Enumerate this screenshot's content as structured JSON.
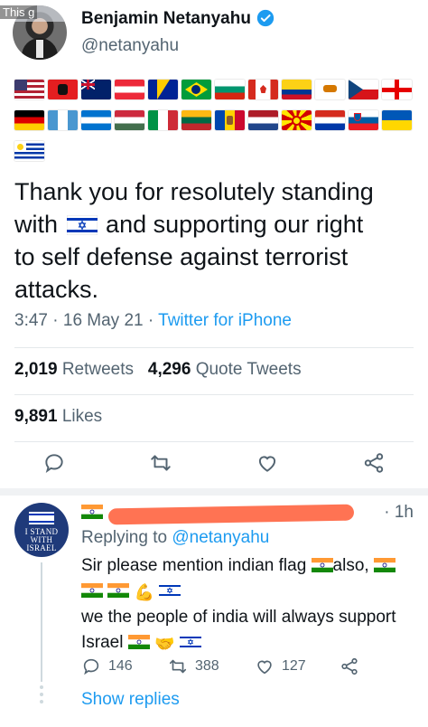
{
  "overlay": {
    "text": "This g"
  },
  "tweet": {
    "author_name": "Benjamin Netanyahu",
    "author_handle": "@netanyahu",
    "text_line1": "Thank you for resolutely standing",
    "text_line2a": "with",
    "text_line2b": "and supporting our right",
    "text_line3": "to self defense against terrorist",
    "text_line4": "attacks.",
    "time": "3:47",
    "date": "16 May 21",
    "source": "Twitter for iPhone",
    "retweets_count": "2,019",
    "retweets_label": "Retweets",
    "quotes_count": "4,296",
    "quotes_label": "Quote Tweets",
    "likes_count": "9,891",
    "likes_label": "Likes"
  },
  "flags_row1": [
    "United States",
    "Albania",
    "Australia",
    "Austria",
    "Bosnia and Herzegovina",
    "Brazil",
    "Bulgaria",
    "Canada",
    "Colombia",
    "Cyprus",
    "Czech Republic",
    "Georgia"
  ],
  "flags_row2": [
    "Germany",
    "Guatemala",
    "Honduras",
    "Hungary",
    "Italy",
    "Lithuania",
    "Moldova",
    "Netherlands",
    "North Macedonia",
    "Paraguay",
    "Slovenia",
    "Ukraine"
  ],
  "flags_row3": [
    "Uruguay"
  ],
  "reply": {
    "time": "1h",
    "replying_label": "Replying to",
    "replying_handle": "@netanyahu",
    "line1": "Sir please mention indian flag",
    "line1b": "also,",
    "line3": "we the people of india will always support",
    "line4": "Israel",
    "reply_count": "146",
    "retweet_count": "388",
    "like_count": "127",
    "show_replies": "Show replies",
    "avatar_text1": "I STAND",
    "avatar_text2": "WITH",
    "avatar_text3": "ISRAEL"
  },
  "colors": {
    "accent": "#1d9bf0",
    "muted": "#536471",
    "text": "#0f1419"
  },
  "icons": [
    "verified-icon",
    "reply-icon",
    "retweet-icon",
    "like-icon",
    "share-icon"
  ]
}
